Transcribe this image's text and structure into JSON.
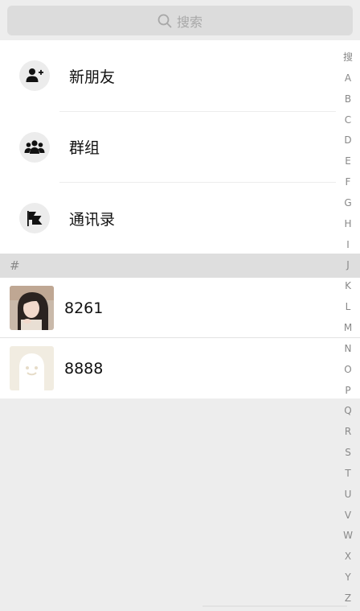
{
  "search": {
    "placeholder": "搜索"
  },
  "top_items": [
    {
      "label": "新朋友",
      "icon": "add-user-icon"
    },
    {
      "label": "群组",
      "icon": "group-icon"
    },
    {
      "label": "通讯录",
      "icon": "flag-icon"
    }
  ],
  "section": {
    "header": "#"
  },
  "contacts": [
    {
      "name": "8261",
      "avatar": "photo-avatar"
    },
    {
      "name": "8888",
      "avatar": "default-ghost-avatar"
    }
  ],
  "index_letters": [
    "搜",
    "A",
    "B",
    "C",
    "D",
    "E",
    "F",
    "G",
    "H",
    "I",
    "J",
    "K",
    "L",
    "M",
    "N",
    "O",
    "P",
    "Q",
    "R",
    "S",
    "T",
    "U",
    "V",
    "W",
    "X",
    "Y",
    "Z"
  ],
  "colors": {
    "background": "#ededed",
    "search_bg": "#dcdcdc",
    "section_bg": "#dedede",
    "index_text": "#888888"
  }
}
